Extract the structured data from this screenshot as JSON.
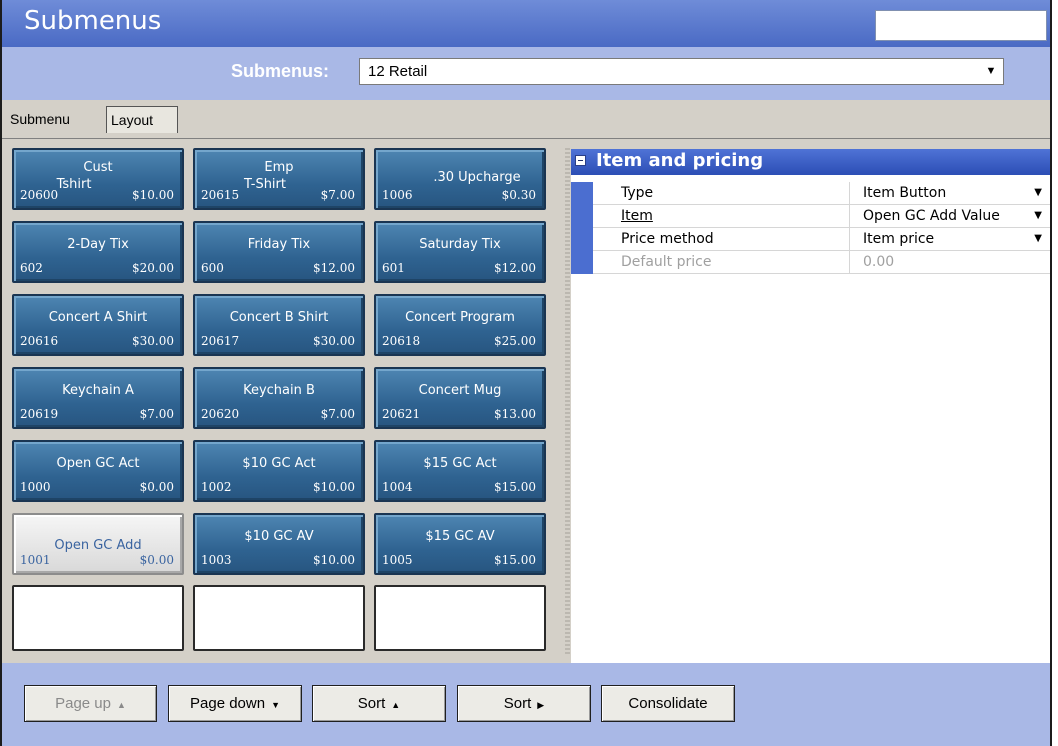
{
  "window": {
    "title": "Submenus",
    "search_value": ""
  },
  "selector": {
    "label": "Submenus:",
    "value": "12 Retail"
  },
  "tabs": [
    {
      "label": "Submenu"
    },
    {
      "label": "Layout"
    }
  ],
  "buttons": [
    {
      "label": "Cust",
      "label2": "Tshirt",
      "number": "20600",
      "price": "$10.00"
    },
    {
      "label": "Emp",
      "label2": "T-Shirt",
      "number": "20615",
      "price": "$7.00"
    },
    {
      "label": ".30 Upcharge",
      "label2": "",
      "number": "1006",
      "price": "$0.30"
    },
    {
      "label": "2-Day Tix",
      "label2": "",
      "number": "602",
      "price": "$20.00"
    },
    {
      "label": "Friday Tix",
      "label2": "",
      "number": "600",
      "price": "$12.00"
    },
    {
      "label": "Saturday Tix",
      "label2": "",
      "number": "601",
      "price": "$12.00"
    },
    {
      "label": "Concert A Shirt",
      "label2": "",
      "number": "20616",
      "price": "$30.00"
    },
    {
      "label": "Concert B Shirt",
      "label2": "",
      "number": "20617",
      "price": "$30.00"
    },
    {
      "label": "Concert Program",
      "label2": "",
      "number": "20618",
      "price": "$25.00"
    },
    {
      "label": "Keychain A",
      "label2": "",
      "number": "20619",
      "price": "$7.00"
    },
    {
      "label": "Keychain B",
      "label2": "",
      "number": "20620",
      "price": "$7.00"
    },
    {
      "label": "Concert Mug",
      "label2": "",
      "number": "20621",
      "price": "$13.00"
    },
    {
      "label": "Open GC Act",
      "label2": "",
      "number": "1000",
      "price": "$0.00"
    },
    {
      "label": "$10 GC Act",
      "label2": "",
      "number": "1002",
      "price": "$10.00"
    },
    {
      "label": "$15 GC Act",
      "label2": "",
      "number": "1004",
      "price": "$15.00"
    },
    {
      "label": "Open GC Add",
      "label2": "",
      "number": "1001",
      "price": "$0.00"
    },
    {
      "label": "$10 GC AV",
      "label2": "",
      "number": "1003",
      "price": "$10.00"
    },
    {
      "label": "$15 GC AV",
      "label2": "",
      "number": "1005",
      "price": "$15.00"
    }
  ],
  "properties": {
    "group_title": "Item and pricing",
    "rows": [
      {
        "name": "Type",
        "value": "Item Button"
      },
      {
        "name": "Item",
        "value": "Open GC Add Value"
      },
      {
        "name": "Price method",
        "value": "Item price"
      },
      {
        "name": "Default price",
        "value": "0.00"
      }
    ]
  },
  "bottom_buttons": [
    {
      "label": "Page up",
      "icon": "▲"
    },
    {
      "label": "Page down",
      "icon": "▼"
    },
    {
      "label": "Sort",
      "icon": "▲"
    },
    {
      "label": "Sort",
      "icon": "▶"
    },
    {
      "label": "Consolidate",
      "icon": ""
    }
  ],
  "icons": {
    "dropdown_arrow": "▼"
  },
  "colors": {
    "title_bar": "#5878cc",
    "menu_button": "#2f6391",
    "selected_button": "#e6e6e6",
    "property_header": "#3a5cc4",
    "background": "#a9b8e6"
  }
}
